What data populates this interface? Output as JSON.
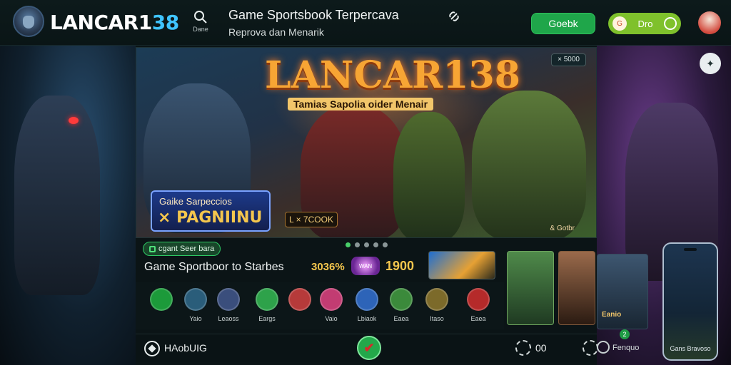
{
  "header": {
    "brand_prefix": "LANCAR1",
    "brand_suffix": "38",
    "search_label": "Dane",
    "title": "Game Sportsbook Terpercava",
    "subtitle": "Reprova dan Menarik",
    "btn_primary": "Goebk",
    "btn_secondary": "Dro",
    "btn_secondary_chip": "G"
  },
  "hero": {
    "title": "LANCAR138",
    "subtitle": "Tamias Sapolia oider Menair",
    "badge": "× 5000",
    "promo_line1": "Gaike Sarpeccios",
    "promo_line2": "× PAGNIINU",
    "cta": "L × 7COOK",
    "mark": "& Gotbr"
  },
  "mid": {
    "pill": "cgant Seer bara",
    "title": "Game Sportboor to Starbes",
    "stat1": "3036%",
    "badge_text": "WAN",
    "stat2": "1900"
  },
  "icons": [
    {
      "name": "lottery-icon",
      "label": "",
      "color": "#1c9a3a"
    },
    {
      "name": "globe-icon",
      "label": "Yaio",
      "color": "#2a5d7a"
    },
    {
      "name": "league-icon",
      "label": "Leaoss",
      "color": "#3a4e7c"
    },
    {
      "name": "sports-icon",
      "label": "Eargs",
      "color": "#2ea24a"
    },
    {
      "name": "bug-icon",
      "label": "",
      "color": "#b63a3a"
    },
    {
      "name": "casino-icon",
      "label": "Vaio",
      "color": "#c23c72"
    },
    {
      "name": "card-icon",
      "label": "Lbiaok",
      "color": "#2d64b8"
    },
    {
      "name": "fish-icon",
      "label": "Eaea",
      "color": "#3b8a3b"
    },
    {
      "name": "slot-icon",
      "label": "Itaso",
      "color": "#7c6a2a"
    },
    {
      "name": "arcade-icon",
      "label": "Eaea",
      "color": "#b52a2a"
    }
  ],
  "cards": {
    "card3_label": "Eanio"
  },
  "phone": {
    "label": "Gans  Bravoso"
  },
  "bottom": {
    "label": "HAobUIG",
    "center_symbol": "✔",
    "count": "00",
    "right_label": "Fenquo",
    "right_badge": "2"
  },
  "right_pin": "✦"
}
